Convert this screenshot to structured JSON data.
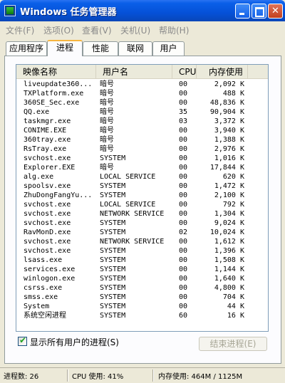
{
  "window": {
    "title": "Windows 任务管理器"
  },
  "menu": [
    "文件(F)",
    "选项(O)",
    "查看(V)",
    "关机(U)",
    "帮助(H)"
  ],
  "tabs": [
    "应用程序",
    "进程",
    "性能",
    "联网",
    "用户"
  ],
  "active_tab": "进程",
  "columns": {
    "name": "映像名称",
    "user": "用户名",
    "cpu": "CPU",
    "mem": "内存使用"
  },
  "processes": [
    {
      "name": "liveupdate360...",
      "user": "暗号",
      "cpu": "00",
      "mem": "2,092 K"
    },
    {
      "name": "TXPlatform.exe",
      "user": "暗号",
      "cpu": "00",
      "mem": "488 K"
    },
    {
      "name": "360SE_Sec.exe",
      "user": "暗号",
      "cpu": "00",
      "mem": "48,836 K"
    },
    {
      "name": "QQ.exe",
      "user": "暗号",
      "cpu": "35",
      "mem": "90,904 K"
    },
    {
      "name": "taskmgr.exe",
      "user": "暗号",
      "cpu": "03",
      "mem": "3,372 K"
    },
    {
      "name": "CONIME.EXE",
      "user": "暗号",
      "cpu": "00",
      "mem": "3,940 K"
    },
    {
      "name": "360tray.exe",
      "user": "暗号",
      "cpu": "00",
      "mem": "1,388 K"
    },
    {
      "name": "RsTray.exe",
      "user": "暗号",
      "cpu": "00",
      "mem": "2,976 K"
    },
    {
      "name": "svchost.exe",
      "user": "SYSTEM",
      "cpu": "00",
      "mem": "1,016 K"
    },
    {
      "name": "Explorer.EXE",
      "user": "暗号",
      "cpu": "00",
      "mem": "17,844 K"
    },
    {
      "name": "alg.exe",
      "user": "LOCAL SERVICE",
      "cpu": "00",
      "mem": "620 K"
    },
    {
      "name": "spoolsv.exe",
      "user": "SYSTEM",
      "cpu": "00",
      "mem": "1,472 K"
    },
    {
      "name": "ZhuDongFangYu...",
      "user": "SYSTEM",
      "cpu": "00",
      "mem": "2,100 K"
    },
    {
      "name": "svchost.exe",
      "user": "LOCAL SERVICE",
      "cpu": "00",
      "mem": "792 K"
    },
    {
      "name": "svchost.exe",
      "user": "NETWORK SERVICE",
      "cpu": "00",
      "mem": "1,304 K"
    },
    {
      "name": "svchost.exe",
      "user": "SYSTEM",
      "cpu": "00",
      "mem": "9,024 K"
    },
    {
      "name": "RavMonD.exe",
      "user": "SYSTEM",
      "cpu": "02",
      "mem": "10,024 K"
    },
    {
      "name": "svchost.exe",
      "user": "NETWORK SERVICE",
      "cpu": "00",
      "mem": "1,612 K"
    },
    {
      "name": "svchost.exe",
      "user": "SYSTEM",
      "cpu": "00",
      "mem": "1,396 K"
    },
    {
      "name": "lsass.exe",
      "user": "SYSTEM",
      "cpu": "00",
      "mem": "1,508 K"
    },
    {
      "name": "services.exe",
      "user": "SYSTEM",
      "cpu": "00",
      "mem": "1,144 K"
    },
    {
      "name": "winlogon.exe",
      "user": "SYSTEM",
      "cpu": "00",
      "mem": "1,640 K"
    },
    {
      "name": "csrss.exe",
      "user": "SYSTEM",
      "cpu": "00",
      "mem": "4,800 K"
    },
    {
      "name": "smss.exe",
      "user": "SYSTEM",
      "cpu": "00",
      "mem": "704 K"
    },
    {
      "name": "System",
      "user": "SYSTEM",
      "cpu": "00",
      "mem": "44 K"
    },
    {
      "name": "系统空闲进程",
      "user": "SYSTEM",
      "cpu": "60",
      "mem": "16 K"
    }
  ],
  "show_all_users": {
    "label": "显示所有用户的进程(S)",
    "checked": true
  },
  "end_process_label": "结束进程(E)",
  "status": {
    "processes": "进程数: 26",
    "cpu": "CPU 使用: 41%",
    "memory": "内存使用: 464M / 1125M"
  }
}
